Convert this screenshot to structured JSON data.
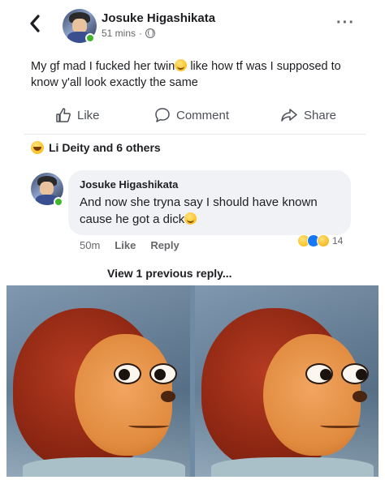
{
  "post": {
    "back_icon": "chevron-left-icon",
    "author": "Josuke Higashikata",
    "time": "51 mins",
    "time_sep": "·",
    "privacy_icon": "globe-icon",
    "more_icon": "more-horizontal-icon",
    "more_label": "···",
    "text_part1": "My gf mad I fucked her twin",
    "text_part2": " like how tf was I supposed to know y'all look exactly the same",
    "text_emoji": "grimacing-emoji-icon"
  },
  "actions": {
    "like": "Like",
    "comment": "Comment",
    "share": "Share"
  },
  "reactions": {
    "icon": "haha-reaction-icon",
    "summary": "Li Deity and 6 others"
  },
  "comment": {
    "author": "Josuke Higashikata",
    "text_line1": "And now she tryna say I should have known",
    "text_line2": "cause he got a dick",
    "text_emoji": "grimacing-emoji-icon",
    "time": "50m",
    "like_label": "Like",
    "reply_label": "Reply",
    "reaction_icons": [
      "haha-reaction-icon",
      "like-reaction-icon",
      "wow-reaction-icon"
    ],
    "reaction_count": "14"
  },
  "view_replies": "View 1 previous reply...",
  "meme": {
    "description_icon": "awkward-puppet-meme-image"
  },
  "colors": {
    "online": "#42b72a",
    "text_secondary": "#65676b",
    "bubble": "#f0f2f5",
    "like_blue": "#1877f2"
  }
}
